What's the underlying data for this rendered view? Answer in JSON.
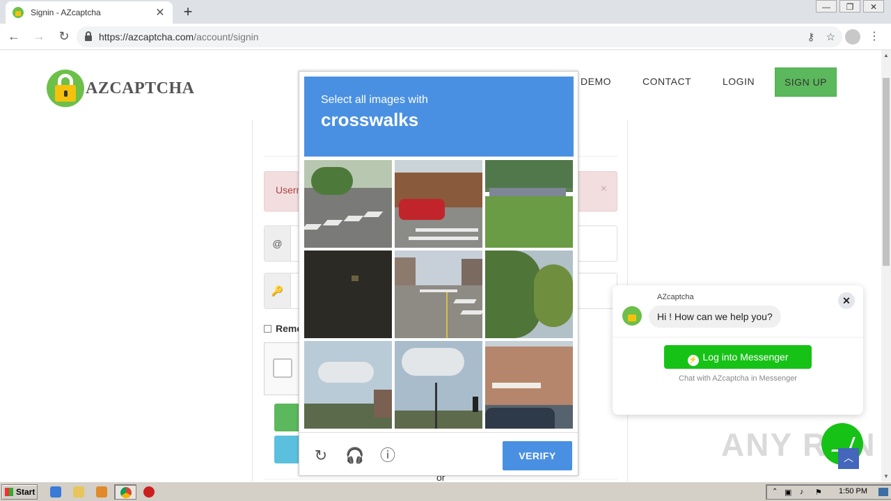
{
  "browser": {
    "tab_title": "Signin - AZcaptcha",
    "tab_close": "✕",
    "new_tab": "+",
    "url_host": "https://azcaptcha.com",
    "url_path": "/account/signin",
    "window_controls": [
      "—",
      "❐",
      "✕"
    ]
  },
  "site": {
    "logo_text": "AZCAPTCHA",
    "nav": {
      "demo": "DEMO",
      "contact": "CONTACT",
      "login": "LOGIN",
      "signup": "SIGN UP"
    }
  },
  "form": {
    "alert_text": "Userr",
    "alert_close": "×",
    "email_addon": "@",
    "password_addon": "🔑",
    "remember_label": "Reme",
    "or_text": "or"
  },
  "captcha": {
    "instruction_sub": "Select all images with",
    "instruction_main": "crosswalks",
    "verify_label": "VERIFY",
    "icons": [
      "reload-icon",
      "audio-icon",
      "info-icon"
    ]
  },
  "chat": {
    "sender": "AZcaptcha",
    "message": "Hi ! How can we help you?",
    "close": "✕",
    "messenger_button": "Log into Messenger",
    "caption": "Chat with AZcaptcha in Messenger"
  },
  "watermark": "ANY RUN",
  "taskbar": {
    "start_label": "Start",
    "clock": "1:50 PM"
  },
  "colors": {
    "captcha_blue": "#4a90e2",
    "brand_green": "#6cc04a",
    "messenger_green": "#17c217"
  }
}
